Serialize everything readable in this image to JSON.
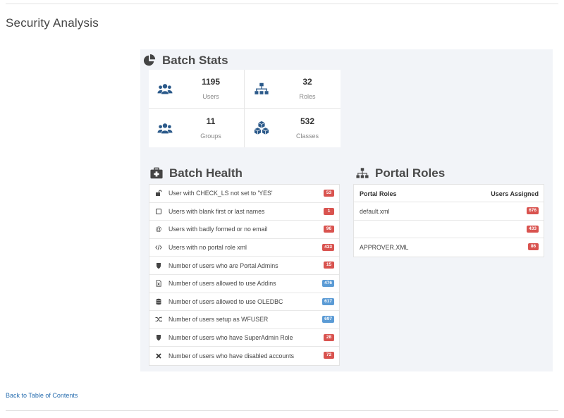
{
  "page": {
    "title": "Security Analysis"
  },
  "batch_stats": {
    "heading": "Batch Stats",
    "icon": "pie-chart-icon",
    "items": [
      {
        "value": "1195",
        "label": "Users",
        "icon": "users-icon"
      },
      {
        "value": "32",
        "label": "Roles",
        "icon": "sitemap-icon"
      },
      {
        "value": "11",
        "label": "Groups",
        "icon": "users-icon"
      },
      {
        "value": "532",
        "label": "Classes",
        "icon": "cubes-icon"
      }
    ]
  },
  "batch_health": {
    "heading": "Batch Health",
    "icon": "medkit-icon",
    "rows": [
      {
        "text": "User with CHECK_LS not set to 'YES'",
        "count": "53",
        "color": "#d9534f",
        "icon": "unlock-icon"
      },
      {
        "text": "Users with blank first or last names",
        "count": "1",
        "color": "#d9534f",
        "icon": "square-icon"
      },
      {
        "text": "Users with badly formed or no email",
        "count": "96",
        "color": "#d9534f",
        "icon": "at-icon"
      },
      {
        "text": "Users with no portal role xml",
        "count": "433",
        "color": "#d9534f",
        "icon": "code-icon"
      },
      {
        "text": "Number of users who are Portal Admins",
        "count": "15",
        "color": "#d9534f",
        "icon": "shield-icon"
      },
      {
        "text": "Number of users allowed to use Addins",
        "count": "476",
        "color": "#5b9bd5",
        "icon": "file-excel-icon"
      },
      {
        "text": "Number of users allowed to use OLEDBC",
        "count": "617",
        "color": "#5b9bd5",
        "icon": "database-icon"
      },
      {
        "text": "Number of users setup as WFUSER",
        "count": "697",
        "color": "#5b9bd5",
        "icon": "random-icon"
      },
      {
        "text": "Number of users who have SuperAdmin Role",
        "count": "28",
        "color": "#d9534f",
        "icon": "shield-icon"
      },
      {
        "text": "Number of users who have disabled accounts",
        "count": "72",
        "color": "#d9534f",
        "icon": "times-icon"
      }
    ]
  },
  "portal_roles": {
    "heading": "Portal Roles",
    "icon": "sitemap-icon",
    "columns": {
      "name": "Portal Roles",
      "assigned": "Users Assigned"
    },
    "rows": [
      {
        "name": "default.xml",
        "count": "676"
      },
      {
        "name": "",
        "count": "433"
      },
      {
        "name": "APPROVER.XML",
        "count": "86"
      }
    ]
  },
  "footer": {
    "back_link": "Back to Table of Contents"
  }
}
